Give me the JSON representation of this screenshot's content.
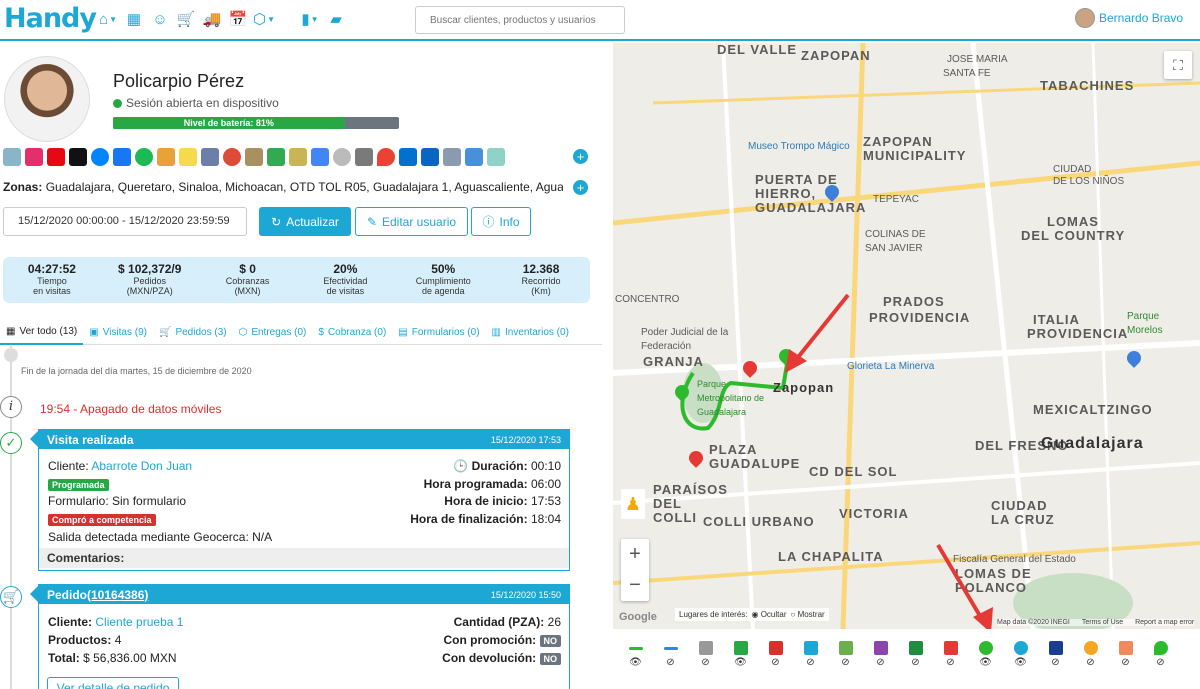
{
  "app": {
    "logo": "Handy"
  },
  "search": {
    "placeholder": "Buscar clientes, productos y usuarios"
  },
  "user": {
    "name": "Bernardo Bravo"
  },
  "profile": {
    "name": "Policarpio Pérez",
    "session": "Sesión abierta en dispositivo",
    "battery_label": "Nivel de batería: 81%",
    "battery_percent": 81,
    "zonas_label": "Zonas:",
    "zonas": "Guadalajara, Queretaro, Sinaloa, Michoacan, OTD TOL R05, Guadalajara 1, Aguascaliente, Aguas..."
  },
  "controls": {
    "daterange": "15/12/2020 00:00:00 - 15/12/2020 23:59:59",
    "update": "Actualizar",
    "edit": "Editar usuario",
    "info": "Info"
  },
  "stats": [
    {
      "value": "04:27:52",
      "label1": "Tiempo",
      "label2": "en visitas"
    },
    {
      "value": "$ 102,372/9",
      "label1": "Pedidos",
      "label2": "(MXN/PZA)"
    },
    {
      "value": "$ 0",
      "label1": "Cobranzas",
      "label2": "(MXN)"
    },
    {
      "value": "20%",
      "label1": "Efectividad",
      "label2": "de visitas"
    },
    {
      "value": "50%",
      "label1": "Cumplimiento",
      "label2": "de agenda"
    },
    {
      "value": "12.368",
      "label1": "Recorrido",
      "label2": "(Km)"
    }
  ],
  "tabs": [
    {
      "label": "Ver todo (13)",
      "icon": "grid-icon"
    },
    {
      "label": "Visitas (9)",
      "icon": "calendar-icon"
    },
    {
      "label": "Pedidos (3)",
      "icon": "cart-icon"
    },
    {
      "label": "Entregas (0)",
      "icon": "box-icon"
    },
    {
      "label": "Cobranza (0)",
      "icon": "dollar-icon"
    },
    {
      "label": "Formularios (0)",
      "icon": "form-icon"
    },
    {
      "label": "Inventarios (0)",
      "icon": "store-icon"
    }
  ],
  "timeline": {
    "end_day": "Fin de la jornada del día martes, 15 de diciembre de 2020",
    "event1": "19:54 - Apagado de datos móviles"
  },
  "visit": {
    "title": "Visita realizada",
    "date": "15/12/2020 17:53",
    "cliente_label": "Cliente:",
    "cliente": "Abarrote Don Juan",
    "badge1": "Programada",
    "formulario": "Formulario: Sin formulario",
    "badge2": "Compró a competencia",
    "salida": "Salida detectada mediante Geocerca:",
    "salida_value": "N/A",
    "duracion_label": "Duración:",
    "duracion": "00:10",
    "hora_programada_label": "Hora programada:",
    "hora_programada": "06:00",
    "hora_inicio_label": "Hora de inicio:",
    "hora_inicio": "17:53",
    "hora_fin_label": "Hora de finalización:",
    "hora_fin": "18:04",
    "comentarios": "Comentarios:"
  },
  "order": {
    "title": "Pedido",
    "number": "(10164386)",
    "date": "15/12/2020 15:50",
    "cliente_label": "Cliente:",
    "cliente": "Cliente prueba 1",
    "productos_label": "Productos:",
    "productos": "4",
    "total_label": "Total:",
    "total": "$ 56,836.00 MXN",
    "cantidad_label": "Cantidad (PZA):",
    "cantidad": "26",
    "promocion_label": "Con promoción:",
    "promocion": "NO",
    "devolucion_label": "Con devolución:",
    "devolucion": "NO",
    "detail": "Ver detalle de pedido"
  },
  "map": {
    "labels": [
      "DEL VALLE",
      "ZAPOPAN",
      "TABACHINES",
      "JOSE MARIA",
      "SANTA FE",
      "Museo Trompo Mágico",
      "ZAPOPAN MUNICIPALITY",
      "PUERTA DE",
      "HIERRO,",
      "GUADALAJARA",
      "TEPEYAC",
      "COLINAS DE SAN JAVIER",
      "CIUDAD",
      "DE LOS NIÑOS",
      "PRADOS",
      "PROVIDENCIA",
      "ITALIA",
      "PROVIDENCIA",
      "LOMAS",
      "DEL COUNTRY",
      "Poder Judicial de la Federación",
      "GRANJA",
      "Glorieta La Minerva",
      "Zapopan",
      "Parque Metropolitano de Guadalajara",
      "MEXICALTZINGO",
      "PLAZA",
      "GUADALUPE",
      "DEL FRESNO",
      "Guadalajara",
      "CD DEL SOL",
      "PARAÍSOS DEL COLLI",
      "VICTORIA",
      "CIUDAD",
      "LA CRUZ",
      "CONCENTRO",
      "COLLI URBANO",
      "LA CHAPALITA",
      "LOMAS DE",
      "POLANCO",
      "Fiscalía General del Estado",
      "Parque Morelos"
    ],
    "places_label": "Lugares de interés:",
    "places_hide": "Ocultar",
    "places_show": "Mostrar",
    "footer": [
      "Map data ©2020 INEGI",
      "Terms of Use",
      "Report a map error"
    ],
    "google": "Google"
  }
}
